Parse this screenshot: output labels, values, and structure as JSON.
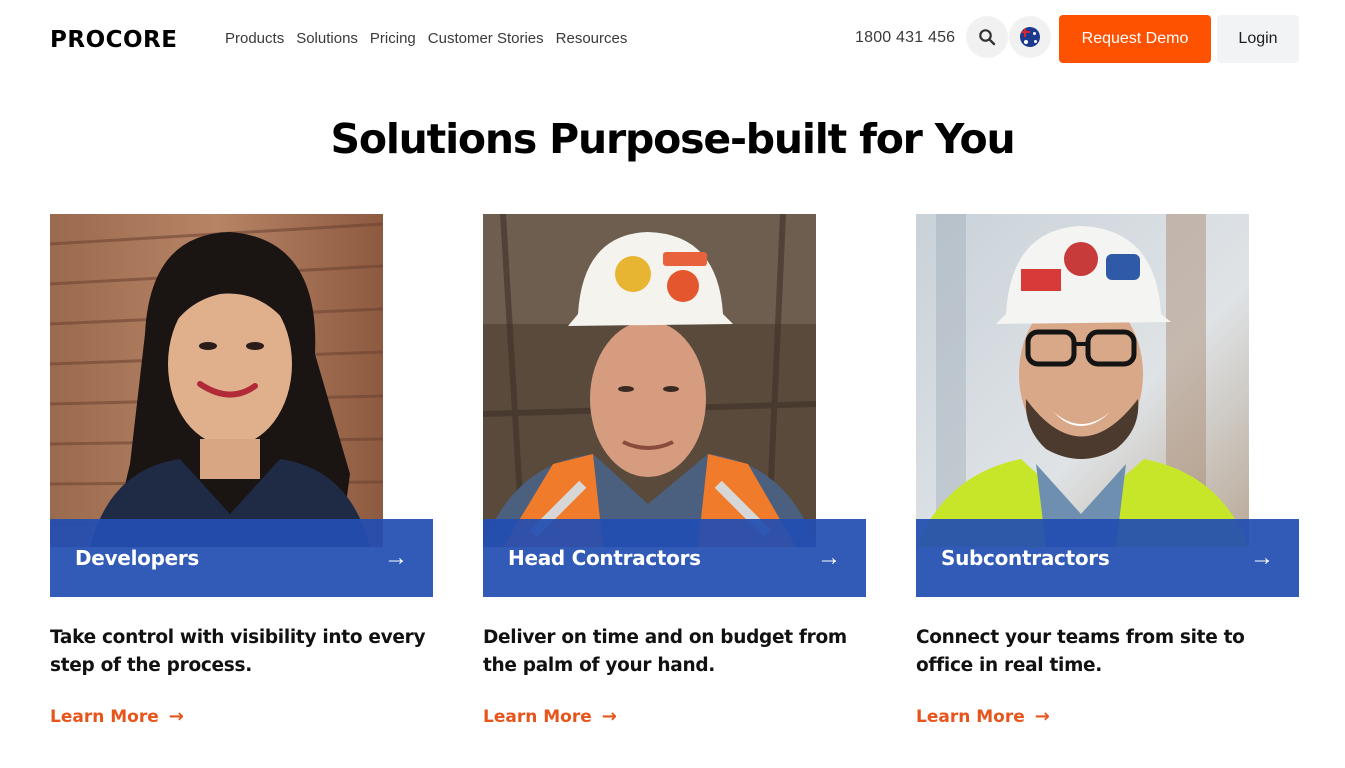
{
  "header": {
    "logo_text": "PROCORE",
    "nav": [
      "Products",
      "Solutions",
      "Pricing",
      "Customer Stories",
      "Resources"
    ],
    "phone": "1800 431 456",
    "search_icon": "search-icon",
    "flag_icon": "australia-flag-icon",
    "request_demo": "Request Demo",
    "login": "Login"
  },
  "main": {
    "heading": "Solutions Purpose-built for You",
    "cards": [
      {
        "title": "Developers",
        "description": "Take control with visibility into every step of the process.",
        "link": "Learn More",
        "photo": "woman-portrait-photo"
      },
      {
        "title": "Head Contractors",
        "description": "Deliver on time and on budget from the palm of your hand.",
        "link": "Learn More",
        "photo": "contractor-hardhat-photo"
      },
      {
        "title": "Subcontractors",
        "description": "Connect your teams from site to office in real time.",
        "link": "Learn More",
        "photo": "worker-glasses-photo"
      }
    ]
  },
  "colors": {
    "accent": "#ff5200",
    "banner_blue": "#224eb2",
    "link_orange": "#e8551c"
  }
}
